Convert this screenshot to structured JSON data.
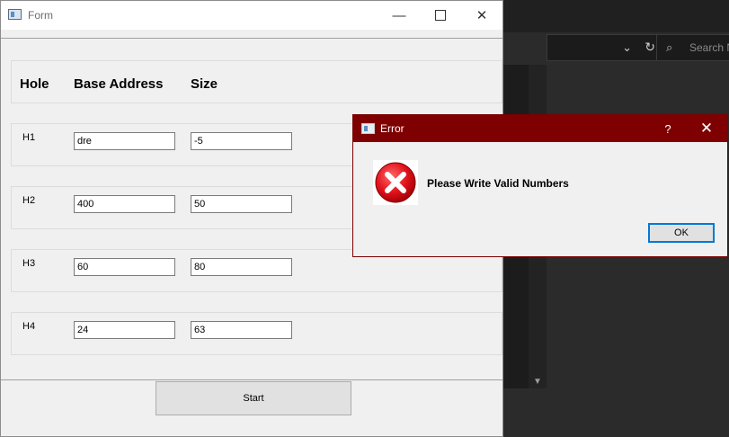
{
  "background_app": {
    "search_placeholder": "Search N",
    "refresh_glyph": "↻",
    "chevron_glyph": "⌄"
  },
  "form": {
    "title": "Form",
    "headers": {
      "hole": "Hole",
      "base_address": "Base Address",
      "size": "Size"
    },
    "rows": [
      {
        "label": "H1",
        "base_address": "dre",
        "size": "-5"
      },
      {
        "label": "H2",
        "base_address": "400",
        "size": "50"
      },
      {
        "label": "H3",
        "base_address": "60",
        "size": "80"
      },
      {
        "label": "H4",
        "base_address": "24",
        "size": "63"
      }
    ],
    "start_label": "Start"
  },
  "error_dialog": {
    "title": "Error",
    "help_glyph": "?",
    "message": "Please Write Valid Numbers",
    "ok_label": "OK",
    "icon": "error-x-icon"
  },
  "colors": {
    "dialog_titlebar": "#7e0000",
    "error_icon_red": "#e2141c",
    "ok_focus_border": "#0078d7"
  }
}
